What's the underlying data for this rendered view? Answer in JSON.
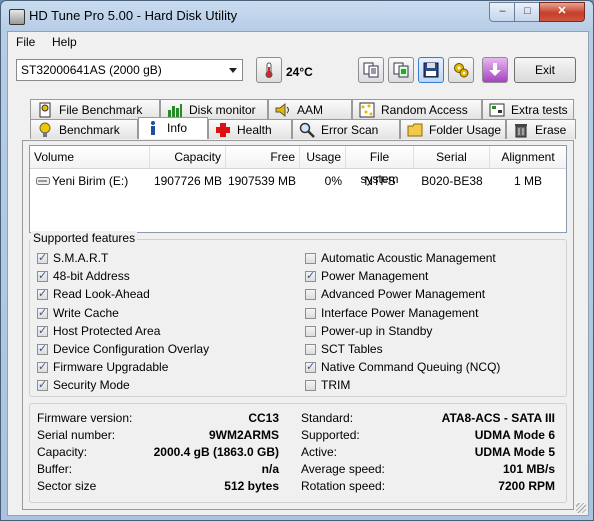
{
  "window": {
    "title": "HD Tune Pro 5.00 - Hard Disk Utility",
    "minimize": "–",
    "maximize": "□",
    "close": "✕"
  },
  "menu": {
    "file": "File",
    "help": "Help"
  },
  "toolbar": {
    "drive": "ST32000641AS (2000 gB)",
    "temperature": "24°C",
    "exit_label": "Exit"
  },
  "tabs_top": [
    {
      "label": "File Benchmark",
      "icon": "file-benchmark-icon"
    },
    {
      "label": "Disk monitor",
      "icon": "disk-monitor-icon"
    },
    {
      "label": "AAM",
      "icon": "speaker-icon"
    },
    {
      "label": "Random Access",
      "icon": "random-access-icon"
    },
    {
      "label": "Extra tests",
      "icon": "extra-tests-icon"
    }
  ],
  "tabs_bottom": [
    {
      "label": "Benchmark",
      "icon": "benchmark-icon"
    },
    {
      "label": "Info",
      "icon": "info-icon",
      "active": true
    },
    {
      "label": "Health",
      "icon": "health-cross-icon"
    },
    {
      "label": "Error Scan",
      "icon": "magnifier-icon"
    },
    {
      "label": "Folder Usage",
      "icon": "folder-icon"
    },
    {
      "label": "Erase",
      "icon": "trash-icon"
    }
  ],
  "volumes": {
    "headers": [
      "Volume",
      "Capacity",
      "Free",
      "Usage",
      "File system",
      "Serial",
      "Alignment"
    ],
    "rows": [
      {
        "volume": "Yeni Birim (E:)",
        "capacity": "1907726 MB",
        "free": "1907539 MB",
        "usage": "0%",
        "fs": "NTFS",
        "serial": "B020-BE38",
        "alignment": "1 MB"
      }
    ]
  },
  "features": {
    "title": "Supported features",
    "left": [
      {
        "label": "S.M.A.R.T",
        "checked": true
      },
      {
        "label": "48-bit Address",
        "checked": true
      },
      {
        "label": "Read Look-Ahead",
        "checked": true
      },
      {
        "label": "Write Cache",
        "checked": true
      },
      {
        "label": "Host Protected Area",
        "checked": true
      },
      {
        "label": "Device Configuration Overlay",
        "checked": true
      },
      {
        "label": "Firmware Upgradable",
        "checked": true
      },
      {
        "label": "Security Mode",
        "checked": true
      }
    ],
    "right": [
      {
        "label": "Automatic Acoustic Management",
        "checked": false
      },
      {
        "label": "Power Management",
        "checked": true
      },
      {
        "label": "Advanced Power Management",
        "checked": false
      },
      {
        "label": "Interface Power Management",
        "checked": false
      },
      {
        "label": "Power-up in Standby",
        "checked": false
      },
      {
        "label": "SCT Tables",
        "checked": false
      },
      {
        "label": "Native Command Queuing (NCQ)",
        "checked": true
      },
      {
        "label": "TRIM",
        "checked": false
      }
    ]
  },
  "details": {
    "left": [
      {
        "label": "Firmware version:",
        "value": "CC13"
      },
      {
        "label": "Serial number:",
        "value": "9WM2ARMS"
      },
      {
        "label": "Capacity:",
        "value": "2000.4 gB (1863.0 GB)"
      },
      {
        "label": "Buffer:",
        "value": "n/a"
      },
      {
        "label": "Sector size",
        "value": "512 bytes"
      }
    ],
    "right": [
      {
        "label": "Standard:",
        "value": "ATA8-ACS - SATA III"
      },
      {
        "label": "Supported:",
        "value": "UDMA Mode 6"
      },
      {
        "label": "Active:",
        "value": "UDMA Mode 5"
      },
      {
        "label": "Average speed:",
        "value": "101 MB/s"
      },
      {
        "label": "Rotation speed:",
        "value": "7200 RPM"
      }
    ]
  }
}
